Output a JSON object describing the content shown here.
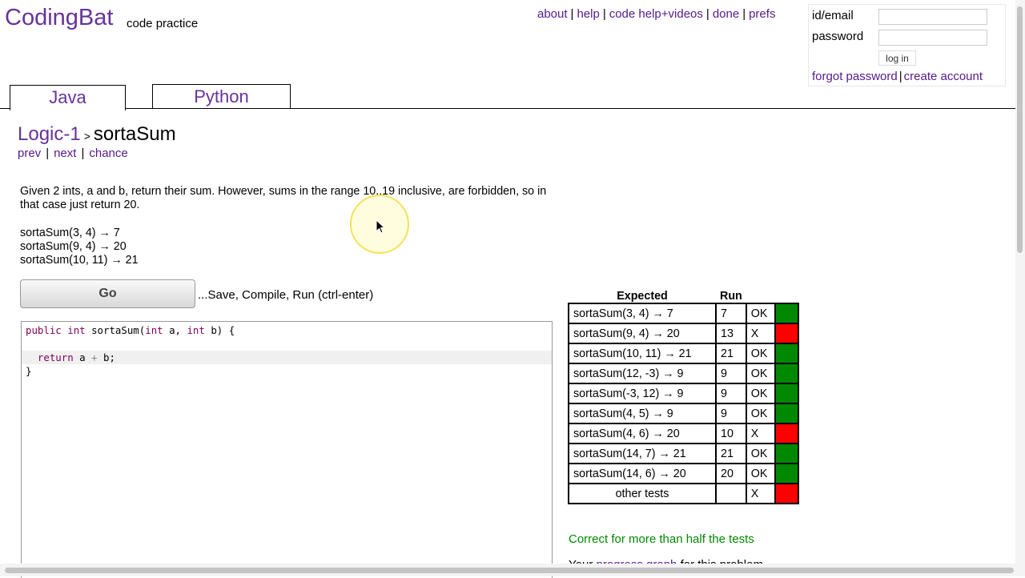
{
  "header": {
    "brand": "CodingBat",
    "subtitle": "code practice",
    "nav": [
      {
        "label": "about"
      },
      {
        "label": "help"
      },
      {
        "label": "code help+videos"
      },
      {
        "label": "done"
      },
      {
        "label": "prefs"
      }
    ]
  },
  "login": {
    "id_label": "id/email",
    "id_value": "",
    "password_label": "password",
    "password_value": "",
    "button_label": "log in",
    "forgot_label": "forgot password",
    "create_label": "create account"
  },
  "tabs": [
    {
      "label": "Java",
      "active": true
    },
    {
      "label": "Python",
      "active": false
    }
  ],
  "problem": {
    "category": "Logic-1",
    "separator": ">",
    "name": "sortaSum",
    "nav": {
      "prev": "prev",
      "next": "next",
      "chance": "chance"
    },
    "description": "Given 2 ints, a and b, return their sum. However, sums in the range 10..19 inclusive, are forbidden, so in that case just return 20.",
    "examples": [
      "sortaSum(3, 4) → 7",
      "sortaSum(9, 4) → 20",
      "sortaSum(10, 11) → 21"
    ]
  },
  "editor": {
    "go_label": "Go",
    "go_hint": "...Save, Compile, Run (ctrl-enter)",
    "code_lines": [
      "public int sortaSum(int a, int b) {",
      "",
      "  return a + b;",
      "}"
    ]
  },
  "results": {
    "headers": {
      "expected": "Expected",
      "run": "Run"
    },
    "rows": [
      {
        "expected": "sortaSum(3, 4) → 7",
        "run": "7",
        "result": "OK",
        "status": "ok"
      },
      {
        "expected": "sortaSum(9, 4) → 20",
        "run": "13",
        "result": "X",
        "status": "fail"
      },
      {
        "expected": "sortaSum(10, 11) → 21",
        "run": "21",
        "result": "OK",
        "status": "ok"
      },
      {
        "expected": "sortaSum(12, -3) → 9",
        "run": "9",
        "result": "OK",
        "status": "ok"
      },
      {
        "expected": "sortaSum(-3, 12) → 9",
        "run": "9",
        "result": "OK",
        "status": "ok"
      },
      {
        "expected": "sortaSum(4, 5) → 9",
        "run": "9",
        "result": "OK",
        "status": "ok"
      },
      {
        "expected": "sortaSum(4, 6) → 20",
        "run": "10",
        "result": "X",
        "status": "fail"
      },
      {
        "expected": "sortaSum(14, 7) → 21",
        "run": "21",
        "result": "OK",
        "status": "ok"
      },
      {
        "expected": "sortaSum(14, 6) → 20",
        "run": "20",
        "result": "OK",
        "status": "ok"
      },
      {
        "expected": "other tests",
        "run": "",
        "result": "X",
        "status": "fail"
      }
    ],
    "summary": "Correct for more than half the tests",
    "progress_prefix": "Your",
    "progress_link": "progress graph",
    "progress_suffix": "for this problem"
  },
  "colors": {
    "brand": "#663399",
    "link": "#551a8b",
    "ok": "#008800",
    "fail": "#ff0000",
    "summary": "#008800"
  }
}
